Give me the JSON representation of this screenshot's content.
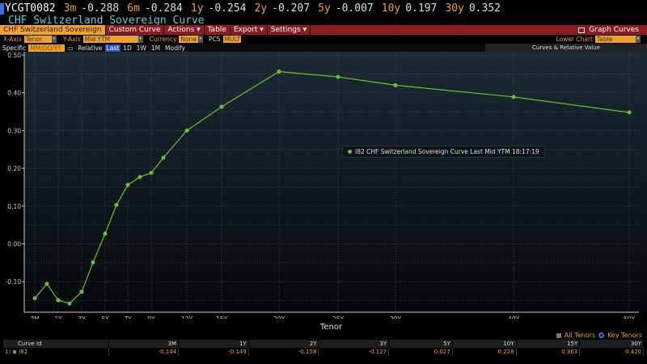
{
  "ticker": {
    "symbol": "YCGT0082",
    "quotes": [
      {
        "tenor": "3m",
        "value": "-0.288"
      },
      {
        "tenor": "6m",
        "value": "-0.284"
      },
      {
        "tenor": "1y",
        "value": "-0.254"
      },
      {
        "tenor": "2y",
        "value": "-0.207"
      },
      {
        "tenor": "5y",
        "value": "-0.007"
      },
      {
        "tenor": "10y",
        "value": "0.197"
      },
      {
        "tenor": "30y",
        "value": "0.352"
      }
    ]
  },
  "subtitle": "CHF Switzerland Sovereign Curve",
  "menu": {
    "items": [
      "CHF Switzerland Sovereign",
      "Custom Curve",
      "Actions ▾",
      "Table",
      "Export ▾",
      "Settings ▾"
    ],
    "graph_curves": "Graph Curves"
  },
  "controls": {
    "x_axis_label": "X-Axis",
    "x_axis_value": "Tenor",
    "y_axis_label": "Y-Axis",
    "y_axis_value": "Mid YTM",
    "currency_label": "Currency",
    "currency_value": "None",
    "pcs_label": "PCS",
    "pcs_value": "MULT",
    "lower_chart_label": "Lower Chart",
    "lower_chart_value": "Table",
    "specific_label": "Specific",
    "date_placeholder": "MM/DD/YY",
    "relative_label": "Relative",
    "periods": [
      "Last",
      "1D",
      "1W",
      "1M"
    ],
    "modify": "Modify",
    "collapse": "«",
    "panel_title": "Curves & Relative Value"
  },
  "tooltip": "I82 CHF Switzerland Sovereign Curve Last Mid YTM 18:17:19",
  "chart_data": {
    "type": "line",
    "xlabel": "Tenor",
    "ylabel": "",
    "ylim": [
      -0.18,
      0.52
    ],
    "grid": true,
    "y_ticks": [
      "0.50",
      "0.40",
      "0.30",
      "0.20",
      "0.10",
      "0.00",
      "-0.10"
    ],
    "x_ticks": [
      "3M",
      "1Y",
      "3Y",
      "5Y",
      "7Y",
      "9Y",
      "12Y",
      "15Y",
      "20Y",
      "25Y",
      "30Y",
      "40Y",
      "50Y"
    ],
    "series": [
      {
        "name": "I82 CHF Switzerland Sovereign Curve",
        "color": "#6cbf3a",
        "points": [
          {
            "tenor": "3M",
            "value": -0.144
          },
          {
            "tenor": "6M",
            "value": -0.106
          },
          {
            "tenor": "1Y",
            "value": -0.149
          },
          {
            "tenor": "2Y",
            "value": -0.158
          },
          {
            "tenor": "3Y",
            "value": -0.127
          },
          {
            "tenor": "4Y",
            "value": -0.049
          },
          {
            "tenor": "5Y",
            "value": 0.027
          },
          {
            "tenor": "6Y",
            "value": 0.103
          },
          {
            "tenor": "7Y",
            "value": 0.156
          },
          {
            "tenor": "8Y",
            "value": 0.177
          },
          {
            "tenor": "9Y",
            "value": 0.188
          },
          {
            "tenor": "10Y",
            "value": 0.228
          },
          {
            "tenor": "12Y",
            "value": 0.3
          },
          {
            "tenor": "15Y",
            "value": 0.363
          },
          {
            "tenor": "20Y",
            "value": 0.456
          },
          {
            "tenor": "25Y",
            "value": 0.442
          },
          {
            "tenor": "30Y",
            "value": 0.42
          },
          {
            "tenor": "40Y",
            "value": 0.389
          },
          {
            "tenor": "50Y",
            "value": 0.348
          }
        ]
      }
    ]
  },
  "legend": {
    "all": "All Tenors",
    "key": "Key Tenors"
  },
  "table": {
    "headers": [
      "Curve Id",
      "3M",
      "1Y",
      "2Y",
      "3Y",
      "5Y",
      "10Y",
      "15Y",
      "30Y"
    ],
    "rows": [
      {
        "num": "1)",
        "id": "I82",
        "values": [
          "-0.144",
          "-0.149",
          "-0.158",
          "-0.127",
          "0.027",
          "0.228",
          "0.363",
          "0.420"
        ]
      }
    ]
  }
}
